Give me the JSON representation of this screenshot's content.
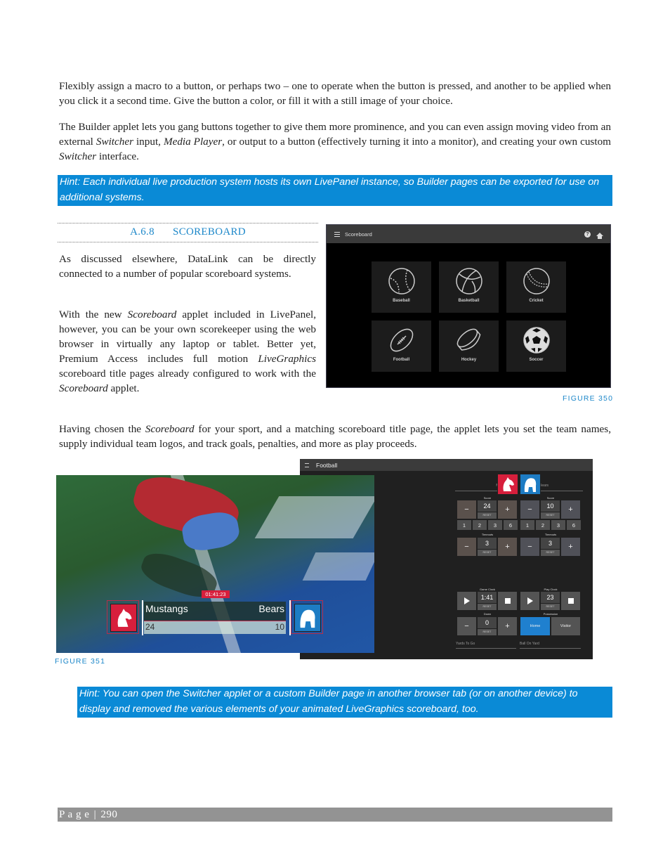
{
  "paragraphs": {
    "p1": "Flexibly assign a macro to a button, or perhaps two – one to operate when the button is pressed, and another to be applied when you click it a second time.  Give the button a color, or fill it with a still image of your choice.",
    "p2_parts": [
      "The Builder applet lets you gang buttons together to give them more prominence, and you can even assign moving video from an external ",
      "Switcher",
      " input, ",
      "Media Player",
      ", or output to a button (effectively turning it into a monitor), and creating your own custom ",
      "Switcher",
      " interface."
    ],
    "p3_parts": [
      "Having chosen the ",
      "Scoreboard",
      " for your sport, and a matching scoreboard title page, the applet lets you set the team names, supply individual team logos, and track goals, penalties, and more as play proceeds."
    ]
  },
  "hints": {
    "hint1": "Hint: Each individual live production system hosts its own LivePanel instance, so Builder pages can be exported for use on additional systems.",
    "hint2": "Hint: You can open the Switcher applet or a custom Builder page in another browser tab (or on another device) to display and removed the various elements of your animated LiveGraphics scoreboard, too."
  },
  "section": {
    "number": "A.6.8",
    "title": "SCOREBOARD",
    "col_p1": "As discussed elsewhere, DataLink can be directly connected to a number of popular scoreboard systems.",
    "col_p2_parts": [
      "With the new ",
      "Scoreboard",
      " applet included in LivePanel, however, you can be your own scorekeeper using the web browser in virtually any laptop or tablet. Better yet, Premium Access includes full motion ",
      "LiveGraphics",
      " scoreboard title pages already configured to work with the ",
      "Scoreboard",
      " applet."
    ]
  },
  "figure350": {
    "caption": "FIGURE 350",
    "app_title": "Scoreboard",
    "icons": [
      "menu-icon",
      "help-icon",
      "home-icon"
    ],
    "sports": [
      {
        "label": "Baseball",
        "icon": "baseball-icon"
      },
      {
        "label": "Basketball",
        "icon": "basketball-icon"
      },
      {
        "label": "Cricket",
        "icon": "cricket-ball-icon"
      },
      {
        "label": "Football",
        "icon": "football-icon"
      },
      {
        "label": "Hockey",
        "icon": "hockey-puck-icon"
      },
      {
        "label": "Soccer",
        "icon": "soccer-ball-icon"
      }
    ]
  },
  "figure351": {
    "caption": "FIGURE 351",
    "overlay": {
      "clock": "01:41:23",
      "home_team": "Mustangs",
      "away_team": "Bears",
      "home_score": "24",
      "away_score": "10"
    },
    "panel": {
      "title": "Football",
      "home_name": "Mustangs",
      "away_name": "Bears",
      "score_label": "Score",
      "home_score": "24",
      "away_score": "10",
      "reset": "RESET",
      "minus": "−",
      "plus": "+",
      "increments": [
        "1",
        "2",
        "3",
        "6"
      ],
      "timeouts_label": "Timeouts",
      "home_timeouts": "3",
      "away_timeouts": "3",
      "game_clock_label": "Game Clock",
      "game_clock": "1:41",
      "play_clock_label": "Play Clock",
      "play_clock": "23",
      "down_label": "Down",
      "down": "0",
      "possession_label": "Possession",
      "possession_home": "Home",
      "possession_visitor": "Visitor",
      "yards_to_go": "Yards To Go",
      "ball_on_yard": "Ball On Yard"
    }
  },
  "footer": {
    "page_label": "P a g e",
    "separator": "|",
    "page_number": "290"
  }
}
